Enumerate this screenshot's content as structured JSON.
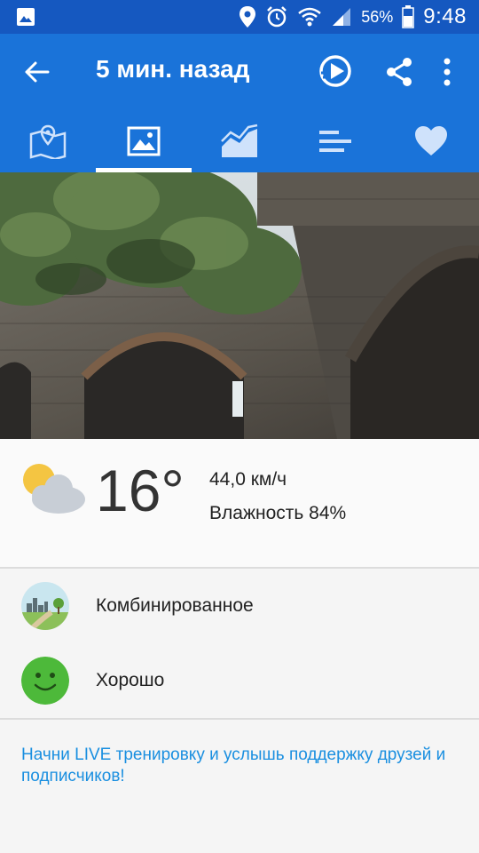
{
  "status_bar": {
    "battery_percent": "56%",
    "time": "9:48",
    "icons": [
      "gallery-icon",
      "location-icon",
      "alarm-icon",
      "wifi-icon",
      "signal-icon",
      "battery-icon"
    ]
  },
  "app_bar": {
    "title": "5 мин. назад",
    "icons": [
      "back-arrow-icon",
      "play-icon",
      "share-icon",
      "more-vert-icon"
    ]
  },
  "tabs": [
    {
      "icon": "map-icon",
      "active": false
    },
    {
      "icon": "photo-icon",
      "active": true
    },
    {
      "icon": "chart-icon",
      "active": false
    },
    {
      "icon": "stats-list-icon",
      "active": false
    },
    {
      "icon": "heart-icon",
      "active": false
    }
  ],
  "weather": {
    "icon": "partly-cloudy-icon",
    "temperature": "16°",
    "wind": "44,0 км/ч",
    "humidity": "Влажность 84%"
  },
  "surface": {
    "label": "Комбинированное",
    "icon": "surface-landscape-icon"
  },
  "feeling": {
    "label": "Хорошо",
    "icon": "smiley-icon"
  },
  "promo_text": "Начни LIVE тренировку и услышь поддержку друзей и подписчиков!",
  "colors": {
    "status_bar": "#1558c0",
    "app_bar": "#1a73d9",
    "link": "#1a8fe0",
    "smiley": "#4db93a"
  }
}
